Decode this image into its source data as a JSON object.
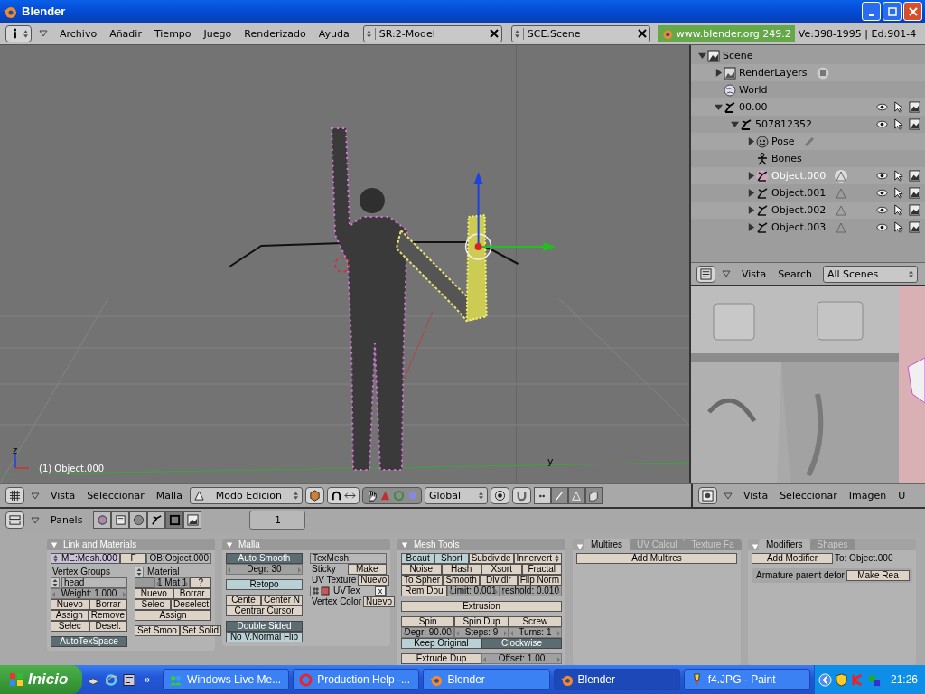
{
  "window": {
    "title": "Blender"
  },
  "menu_bar": {
    "menus": [
      "Archivo",
      "Añadir",
      "Tiempo",
      "Juego",
      "Renderizado",
      "Ayuda"
    ],
    "screen": "SR:2-Model",
    "scene": "SCE:Scene",
    "version": "www.blender.org 249.2",
    "stats": "Ve:398-1995 | Ed:901-4"
  },
  "viewport": {
    "object_label": "(1) Object.000",
    "axis_letter": "z",
    "ground_letter": "y"
  },
  "outliner": {
    "items": [
      {
        "label": "Scene",
        "kind": "scene",
        "expanded": true,
        "selected": false,
        "restrict": false,
        "children": [
          {
            "label": "RenderLayers",
            "kind": "renderlayers",
            "expanded": false,
            "selected": false,
            "restrict": false
          },
          {
            "label": "World",
            "kind": "world",
            "selected": false,
            "restrict": false
          },
          {
            "label": "00.00",
            "kind": "armature",
            "expanded": true,
            "selected": false,
            "restrict": true,
            "children": [
              {
                "label": "507812352",
                "kind": "armature",
                "expanded": true,
                "selected": false,
                "restrict": true,
                "children": [
                  {
                    "label": "Pose",
                    "kind": "pose",
                    "expanded": false,
                    "selected": false,
                    "restrict": false
                  },
                  {
                    "label": "Bones",
                    "kind": "bones",
                    "selected": false,
                    "restrict": false
                  },
                  {
                    "label": "Object.000",
                    "kind": "object",
                    "expanded": false,
                    "selected": true,
                    "restrict": true
                  },
                  {
                    "label": "Object.001",
                    "kind": "object",
                    "expanded": false,
                    "selected": false,
                    "restrict": true
                  },
                  {
                    "label": "Object.002",
                    "kind": "object",
                    "expanded": false,
                    "selected": false,
                    "restrict": true
                  },
                  {
                    "label": "Object.003",
                    "kind": "object",
                    "expanded": false,
                    "selected": false,
                    "restrict": true
                  }
                ]
              }
            ]
          }
        ]
      }
    ],
    "header": {
      "menus": [
        "Vista",
        "Search"
      ],
      "scope": "All Scenes"
    }
  },
  "view3d_header": {
    "menus": [
      "Vista",
      "Seleccionar",
      "Malla"
    ],
    "mode": "Modo Edicion",
    "orientation": "Global",
    "select_modes": [
      {
        "kind": "vertex",
        "selected": true
      },
      {
        "kind": "edge",
        "selected": false
      },
      {
        "kind": "face",
        "selected": false
      }
    ]
  },
  "image_header": {
    "menus": [
      "Vista",
      "Seleccionar",
      "Imagen",
      "U"
    ]
  },
  "buttons_header": {
    "label": "Panels",
    "contexts": [
      {
        "kind": "logic",
        "selected": false
      },
      {
        "kind": "script",
        "selected": false
      },
      {
        "kind": "shading",
        "selected": false
      },
      {
        "kind": "object",
        "selected": false
      },
      {
        "kind": "editing",
        "selected": true
      },
      {
        "kind": "scene",
        "selected": false
      }
    ],
    "frame": "1"
  },
  "panels": [
    {
      "title": "Link and Materials",
      "sections": [
        {
          "columns": [
            [
              {
                "cells": [
                  {
                    "kind": "id",
                    "text": "ME:Mesh.000"
                  },
                  {
                    "kind": "button",
                    "text": "F"
                  },
                  {
                    "kind": "field",
                    "text": "OB:Object.000"
                  }
                ]
              }
            ]
          ]
        },
        {
          "columns": [
            [
              {
                "cells": [
                  {
                    "kind": "label",
                    "text": "Vertex Groups"
                  }
                ]
              },
              {
                "cells": [
                  {
                    "kind": "updown"
                  },
                  {
                    "kind": "field",
                    "text": "head"
                  }
                ]
              },
              {
                "cells": [
                  {
                    "kind": "num",
                    "text": "Weight: 1.000"
                  }
                ]
              },
              {
                "cells": [
                  {
                    "kind": "button",
                    "text": "Nuevo"
                  },
                  {
                    "kind": "button",
                    "text": "Borrar"
                  }
                ]
              },
              {
                "cells": [
                  {
                    "kind": "button",
                    "text": "Assign"
                  },
                  {
                    "kind": "button",
                    "text": "Remove"
                  }
                ]
              },
              {
                "cells": [
                  {
                    "kind": "button",
                    "text": "Selec"
                  },
                  {
                    "kind": "button",
                    "text": "Desel."
                  }
                ]
              },
              {
                "spaced": true,
                "cells": [
                  {
                    "kind": "toggle",
                    "text": "AutoTexSpace",
                    "on": true
                  }
                ]
              }
            ],
            [
              {
                "cells": [
                  {
                    "kind": "updown"
                  },
                  {
                    "kind": "label",
                    "text": "Material"
                  }
                ]
              },
              {
                "cells": [
                  {
                    "kind": "swatch"
                  },
                  {
                    "kind": "num",
                    "text": "1 Mat 1"
                  },
                  {
                    "kind": "button",
                    "text": "?"
                  }
                ]
              },
              {
                "cells": [
                  {
                    "kind": "button",
                    "text": "Nuevo"
                  },
                  {
                    "kind": "button",
                    "text": "Borrar"
                  }
                ]
              },
              {
                "cells": [
                  {
                    "kind": "button",
                    "text": "Selec"
                  },
                  {
                    "kind": "button",
                    "text": "Deselect"
                  }
                ]
              },
              {
                "cells": [
                  {
                    "kind": "button",
                    "text": "Assign"
                  }
                ]
              },
              {
                "spaced": true,
                "cells": [
                  {
                    "kind": "button",
                    "text": "Set Smoo"
                  },
                  {
                    "kind": "button",
                    "text": "Set Solid"
                  }
                ]
              }
            ]
          ]
        }
      ]
    },
    {
      "title": "Malla",
      "sections": [
        {
          "columns": [
            [
              {
                "cells": [
                  {
                    "kind": "toggle",
                    "text": "Auto Smooth",
                    "on": true
                  }
                ]
              },
              {
                "cells": [
                  {
                    "kind": "num",
                    "text": "Degr: 30"
                  }
                ]
              },
              {
                "spaced": true,
                "cells": [
                  {
                    "kind": "toggle",
                    "text": "Retopo",
                    "on": false
                  }
                ]
              },
              {
                "spaced": true,
                "cells": [
                  {
                    "kind": "button",
                    "text": "Cente"
                  },
                  {
                    "kind": "button",
                    "text": "Center N"
                  }
                ]
              },
              {
                "cells": [
                  {
                    "kind": "button",
                    "text": "Centrar Cursor"
                  }
                ]
              },
              {
                "spaced": true,
                "cells": [
                  {
                    "kind": "toggle",
                    "text": "Double Sided",
                    "on": true
                  }
                ]
              },
              {
                "cells": [
                  {
                    "kind": "toggle",
                    "text": "No V.Normal Flip",
                    "on": false
                  }
                ]
              }
            ],
            [
              {
                "cells": [
                  {
                    "kind": "field",
                    "text": "TexMesh:"
                  }
                ]
              },
              {
                "cells": [
                  {
                    "kind": "label",
                    "text": "Sticky"
                  },
                  {
                    "kind": "button",
                    "text": "Make"
                  }
                ]
              },
              {
                "cells": [
                  {
                    "kind": "label",
                    "text": "UV Texture"
                  },
                  {
                    "kind": "button",
                    "text": "Nuevo"
                  }
                ]
              },
              {
                "cells": [
                  {
                    "kind": "layer",
                    "text": "UVTex",
                    "close": "x"
                  }
                ]
              },
              {
                "cells": [
                  {
                    "kind": "label",
                    "text": "Vertex Color"
                  },
                  {
                    "kind": "button",
                    "text": "Nuevo"
                  }
                ]
              }
            ]
          ]
        }
      ]
    },
    {
      "title": "Mesh Tools",
      "sections": [
        {
          "columns": [
            [
              {
                "cells": [
                  {
                    "kind": "toggle",
                    "text": "Beaut",
                    "on": false
                  },
                  {
                    "kind": "toggle",
                    "text": "Short",
                    "on": false
                  },
                  {
                    "kind": "button",
                    "text": "Subdivide"
                  },
                  {
                    "kind": "menu",
                    "text": "Innervert"
                  }
                ]
              },
              {
                "cells": [
                  {
                    "kind": "button",
                    "text": "Noise"
                  },
                  {
                    "kind": "button",
                    "text": "Hash"
                  },
                  {
                    "kind": "button",
                    "text": "Xsort"
                  },
                  {
                    "kind": "button",
                    "text": "Fractal"
                  }
                ]
              },
              {
                "cells": [
                  {
                    "kind": "button",
                    "text": "To Spher"
                  },
                  {
                    "kind": "button",
                    "text": "Smooth"
                  },
                  {
                    "kind": "button",
                    "text": "Dividir"
                  },
                  {
                    "kind": "button",
                    "text": "Flip Norm"
                  }
                ]
              },
              {
                "cells": [
                  {
                    "kind": "button",
                    "text": "Rem Dou"
                  },
                  {
                    "kind": "num",
                    "text": "Limit: 0.001"
                  },
                  {
                    "kind": "num",
                    "text": "reshold: 0.010"
                  }
                ]
              },
              {
                "spaced": true,
                "cells": [
                  {
                    "kind": "button",
                    "text": "Extrusion"
                  }
                ]
              },
              {
                "spaced": true,
                "cells": [
                  {
                    "kind": "button",
                    "text": "Spin"
                  },
                  {
                    "kind": "button",
                    "text": "Spin Dup"
                  },
                  {
                    "kind": "button",
                    "text": "Screw"
                  }
                ]
              },
              {
                "cells": [
                  {
                    "kind": "num",
                    "text": "Degr: 90.00"
                  },
                  {
                    "kind": "num",
                    "text": "Steps: 9"
                  },
                  {
                    "kind": "num",
                    "text": "Turns: 1"
                  }
                ]
              },
              {
                "cells": [
                  {
                    "kind": "toggle",
                    "text": "Keep Original",
                    "on": false
                  },
                  {
                    "kind": "toggle",
                    "text": "Clockwise",
                    "on": true
                  }
                ]
              },
              {
                "spaced": true,
                "cells": [
                  {
                    "kind": "button",
                    "text": "Extrude Dup"
                  },
                  {
                    "kind": "num",
                    "text": "Offset: 1.00"
                  }
                ]
              }
            ]
          ]
        }
      ]
    },
    {
      "tabs": [
        {
          "label": "Multires",
          "selected": true
        },
        {
          "label": "UV Calcul",
          "selected": false
        },
        {
          "label": "Texture Fa",
          "selected": false
        }
      ],
      "sections": [
        {
          "columns": [
            [
              {
                "cells": [
                  {
                    "kind": "button",
                    "text": "Add Multires"
                  }
                ]
              }
            ]
          ]
        }
      ]
    },
    {
      "tabs": [
        {
          "label": "Modifiers",
          "selected": true
        },
        {
          "label": "Shapes",
          "selected": false
        }
      ],
      "sections": [
        {
          "columns": [
            [
              {
                "cells": [
                  {
                    "kind": "button",
                    "text": "Add Modifier"
                  },
                  {
                    "kind": "label",
                    "text": "To: Object.000"
                  }
                ]
              },
              {
                "spaced": true,
                "cells": [
                  {
                    "kind": "label",
                    "text": "Armature parent defor"
                  },
                  {
                    "kind": "button",
                    "text": "Make Rea"
                  }
                ]
              }
            ]
          ]
        }
      ]
    }
  ],
  "taskbar": {
    "start": "Inicio",
    "more": "»",
    "tasks": [
      {
        "label": "Windows Live Me...",
        "kind": "messenger",
        "selected": false
      },
      {
        "label": "Production Help -...",
        "kind": "opera",
        "selected": false
      },
      {
        "label": "Blender",
        "kind": "blender",
        "selected": false
      },
      {
        "label": "Blender",
        "kind": "blender",
        "selected": true
      },
      {
        "label": "f4.JPG - Paint",
        "kind": "paint",
        "selected": false
      }
    ],
    "clock": "21:26"
  }
}
